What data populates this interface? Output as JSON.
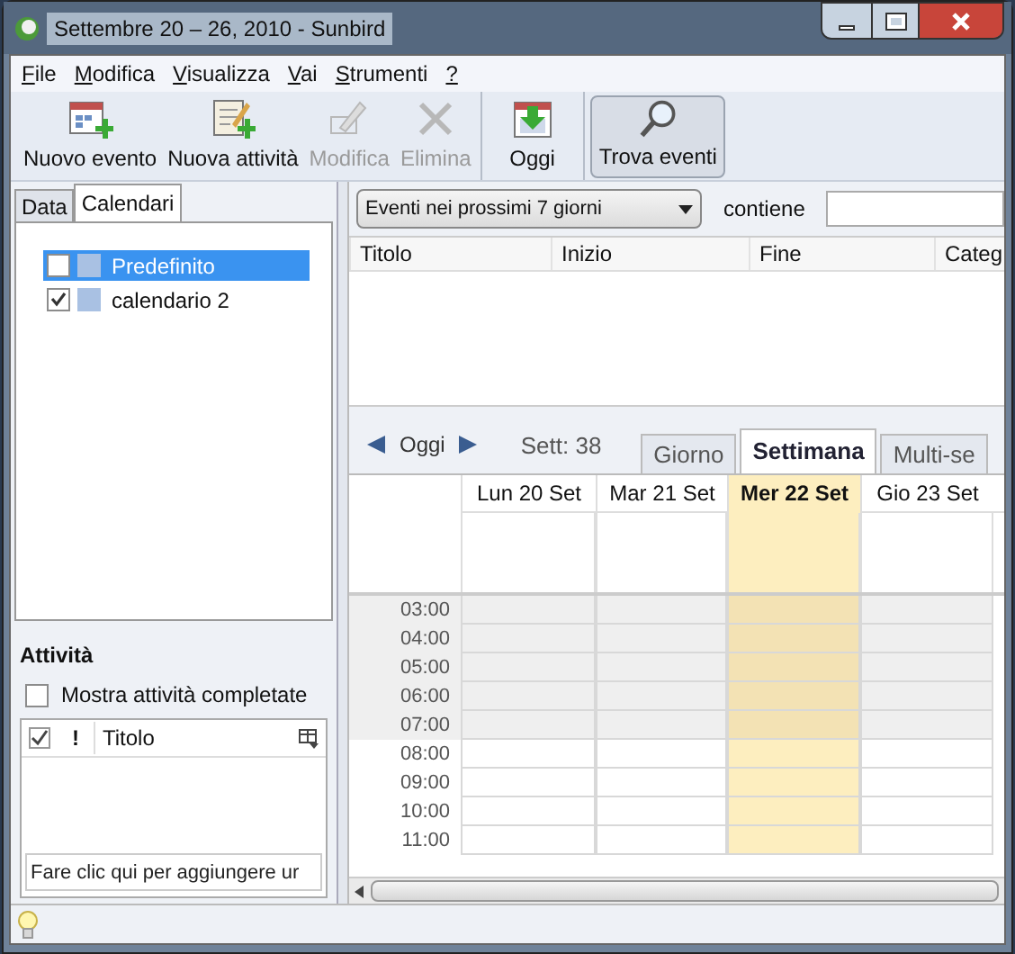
{
  "window": {
    "title": "Settembre 20 – 26, 2010 - Sunbird"
  },
  "menu": [
    "File",
    "Modifica",
    "Visualizza",
    "Vai",
    "Strumenti",
    "?"
  ],
  "toolbar": [
    [
      {
        "label": "Nuovo evento",
        "disabled": false,
        "pressed": false
      },
      {
        "label": "Nuova attività",
        "disabled": false,
        "pressed": false
      },
      {
        "label": "Modifica",
        "disabled": true,
        "pressed": false
      },
      {
        "label": "Elimina",
        "disabled": true,
        "pressed": false
      }
    ],
    [
      {
        "label": "Oggi",
        "disabled": false,
        "pressed": false
      }
    ],
    [
      {
        "label": "Trova eventi",
        "disabled": false,
        "pressed": true
      }
    ]
  ],
  "sidebar": {
    "tabs": [
      {
        "label": "Data",
        "selected": false
      },
      {
        "label": "Calendari",
        "selected": true
      }
    ],
    "calendars": [
      {
        "name": "Predefinito",
        "checked": false,
        "selected": true,
        "color": "#a9c1e3"
      },
      {
        "name": "calendario 2",
        "checked": true,
        "selected": false,
        "color": "#a9c1e3"
      }
    ],
    "tasks": {
      "heading": "Attività",
      "show_completed": {
        "label": "Mostra attività completate",
        "checked": false
      },
      "columns": [
        "!",
        "Titolo"
      ],
      "new_task": {
        "placeholder": "Fare clic qui per aggiungere ur"
      }
    }
  },
  "search": {
    "filter": "Eventi nei prossimi 7 giorni",
    "contains_label": "contiene"
  },
  "results": {
    "columns": [
      "Titolo",
      "Inizio",
      "Fine",
      "Categ"
    ]
  },
  "nav": {
    "today": "Oggi",
    "week": "Sett: 38"
  },
  "view_tabs": [
    {
      "label": "Giorno",
      "selected": false
    },
    {
      "label": "Settimana",
      "selected": true
    },
    {
      "label": "Multi-se",
      "selected": false
    }
  ],
  "days": [
    {
      "label": "Lun 20 Set",
      "today": false
    },
    {
      "label": "Mar 21 Set",
      "today": false
    },
    {
      "label": "Mer 22 Set",
      "today": true
    },
    {
      "label": "Gio 23 Set",
      "today": false
    }
  ],
  "hours": [
    {
      "label": "03:00",
      "off_hours": true
    },
    {
      "label": "04:00",
      "off_hours": true
    },
    {
      "label": "05:00",
      "off_hours": true
    },
    {
      "label": "06:00",
      "off_hours": true
    },
    {
      "label": "07:00",
      "off_hours": true
    },
    {
      "label": "08:00",
      "off_hours": false
    },
    {
      "label": "09:00",
      "off_hours": false
    },
    {
      "label": "10:00",
      "off_hours": false
    },
    {
      "label": "11:00",
      "off_hours": false
    }
  ]
}
